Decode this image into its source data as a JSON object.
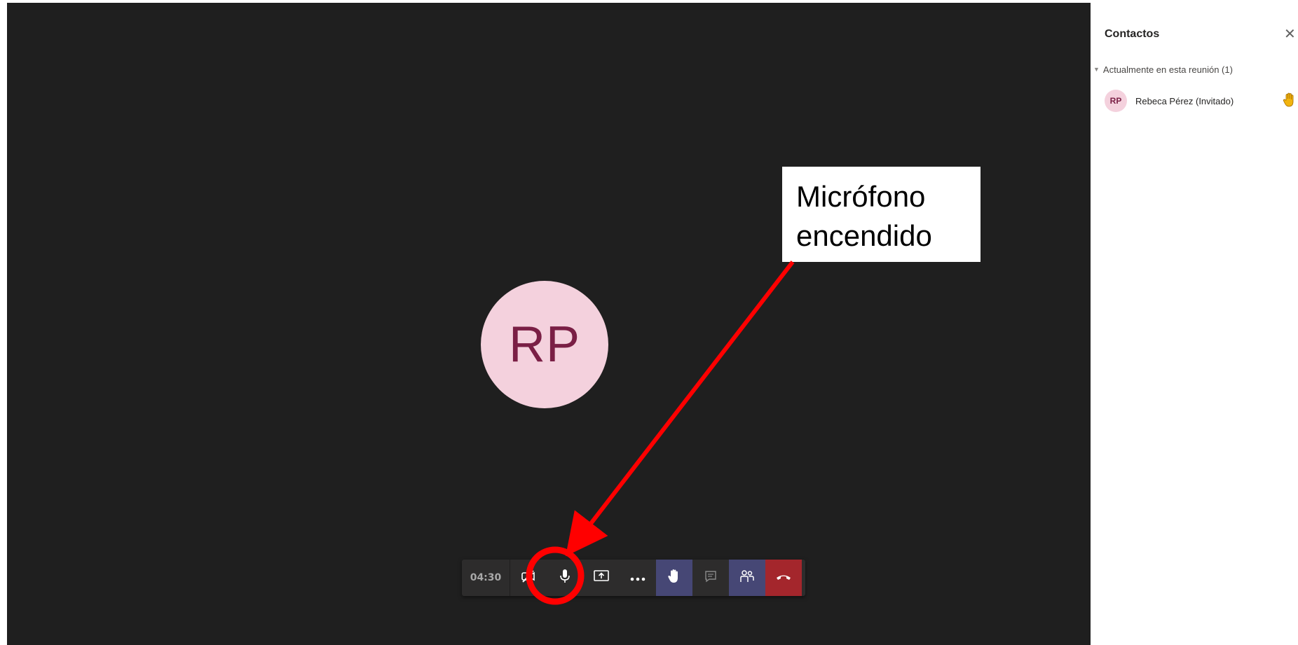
{
  "stage": {
    "avatar_initials": "RP"
  },
  "toolbar": {
    "timer": "04:30",
    "buttons": {
      "camera": "camera-off-icon",
      "microphone": "microphone-icon",
      "share": "share-screen-icon",
      "more": "more-icon",
      "raise_hand": "raise-hand-icon",
      "chat": "chat-icon",
      "people": "people-icon",
      "hangup": "hangup-icon"
    },
    "colors": {
      "active": "#464775",
      "hangup": "#a4262c"
    }
  },
  "panel": {
    "title": "Contactos",
    "section": "Actualmente en esta reunión (1)",
    "participants": [
      {
        "initials": "RP",
        "name": "Rebeca Pérez (Invitado)",
        "hand_raised": true
      }
    ]
  },
  "annotation": {
    "line1": "Micrófono",
    "line2": "encendido",
    "color": "#ff0000"
  }
}
